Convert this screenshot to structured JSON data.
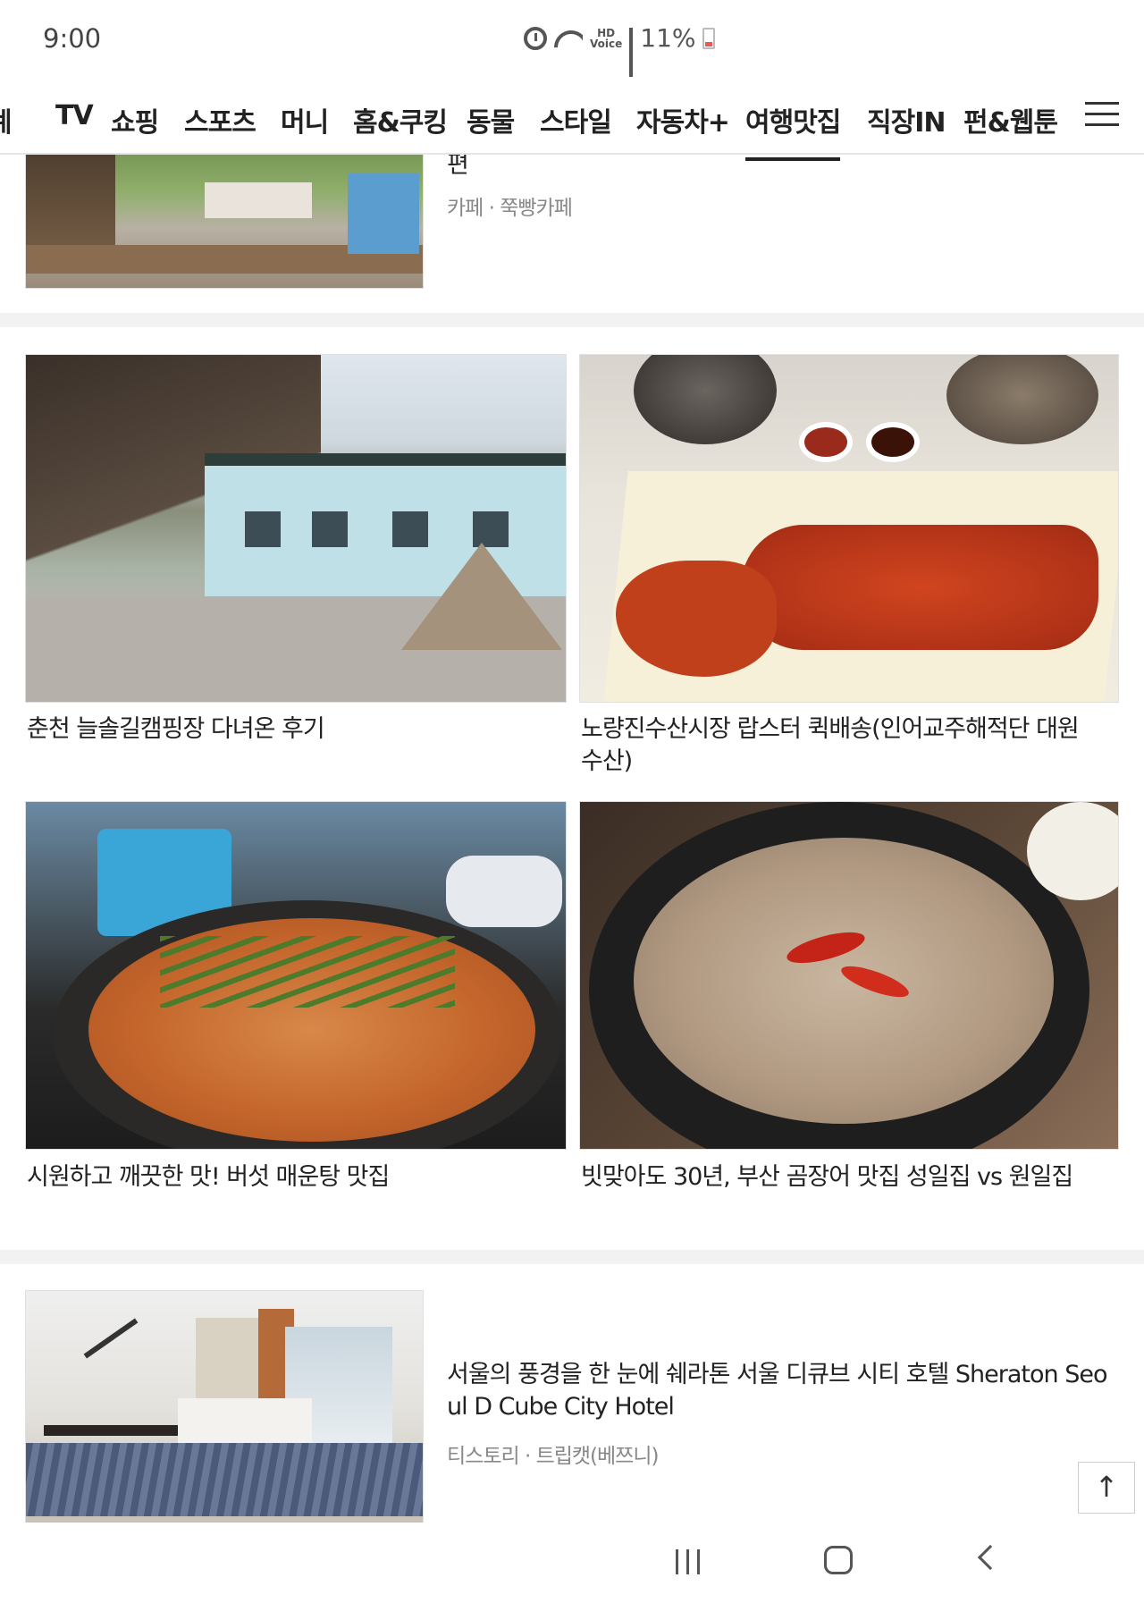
{
  "status": {
    "time": "9:00",
    "hd_label": "HD\nVoice",
    "battery": "11%"
  },
  "tabs": [
    {
      "label": "계",
      "active": false
    },
    {
      "label": "TV",
      "active": false
    },
    {
      "label": "쇼핑",
      "active": false
    },
    {
      "label": "스포츠",
      "active": false
    },
    {
      "label": "머니",
      "active": false
    },
    {
      "label": "홈&쿠킹",
      "active": false
    },
    {
      "label": "동물",
      "active": false
    },
    {
      "label": "스타일",
      "active": false
    },
    {
      "label": "자동차+",
      "active": false
    },
    {
      "label": "여행맛집",
      "active": true
    },
    {
      "label": "직장IN",
      "active": false
    },
    {
      "label": "펀&웹툰",
      "active": false
    }
  ],
  "top_card": {
    "title_tail": "편",
    "meta": "카페 · 쭉빵카페",
    "image_icon": "street-market-photo"
  },
  "grid": [
    {
      "title": "춘천 늘솔길캠핑장 다녀온 후기",
      "image_icon": "campsite-photo"
    },
    {
      "title": "노량진수산시장 랍스터 퀵배송(인어교주해적단 대원수산)",
      "image_icon": "lobster-photo"
    },
    {
      "title": "시원하고 깨끗한 맛! 버섯 매운탕 맛집",
      "image_icon": "spicy-stew-photo"
    },
    {
      "title": "빗맞아도 30년, 부산 곰장어 맛집 성일집 vs 원일집",
      "image_icon": "grilled-eel-photo"
    }
  ],
  "bottom_card": {
    "title": "서울의 풍경을 한 눈에 쉐라톤 서울 디큐브 시티 호텔 Sheraton Seoul D Cube City Hotel",
    "meta": "티스토리 · 트립캣(베쯔니)",
    "image_icon": "hotel-room-photo"
  },
  "scroll_top_icon": "↑",
  "colors": {
    "text": "#222222",
    "meta": "#888888",
    "divider": "#f2f2f2",
    "active_underline": "#222222"
  }
}
